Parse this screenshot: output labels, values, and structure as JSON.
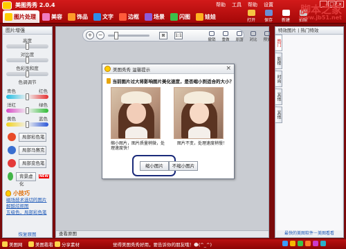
{
  "app": {
    "title": "美图秀秀 2.0.4"
  },
  "top_links": [
    "帮助",
    "工具",
    "帮助",
    "设置"
  ],
  "window_buttons": [
    "_",
    "□",
    "×"
  ],
  "main_tabs": [
    {
      "label": "图片处理",
      "color": "#ffcc00"
    },
    {
      "label": "美容",
      "color": "#f07bbf"
    },
    {
      "label": "饰品",
      "color": "#ff9a2a"
    },
    {
      "label": "文字",
      "color": "#2f8ee8"
    },
    {
      "label": "边框",
      "color": "#ff5a3a"
    },
    {
      "label": "场景",
      "color": "#8e5bd8"
    },
    {
      "label": "闪图",
      "color": "#3bbf4a"
    },
    {
      "label": "娃娃",
      "color": "#ffb020"
    }
  ],
  "top_tools": [
    {
      "label": "打开",
      "color": "#f5c542"
    },
    {
      "label": "保存",
      "color": "#6a8fd6"
    },
    {
      "label": "新建",
      "color": "#ffffff"
    },
    {
      "label": "拍照",
      "color": "#cccccc"
    }
  ],
  "watermark": {
    "text": "脚本之家",
    "url": "www.jb51.net"
  },
  "left_panel": {
    "header": "图片增强",
    "sliders": [
      {
        "label": "高度",
        "type": "plain",
        "value": 0.5
      },
      {
        "label": "对比度",
        "type": "plain",
        "value": 0.5
      },
      {
        "label": "色彩饱和度",
        "type": "plain",
        "value": 0.5
      },
      {
        "label": "色调调节",
        "type": "cyan",
        "left": "青色",
        "right": "红色",
        "value": 0.5
      },
      {
        "type": "mag",
        "left": "洋红",
        "right": "绿色",
        "value": 0.5
      },
      {
        "type": "yel",
        "left": "黄色",
        "right": "蓝色",
        "value": 0.5
      }
    ],
    "effects": [
      {
        "label": "局部彩色笔",
        "color": "#e84a28"
      },
      {
        "label": "局部马赛克",
        "color": "#3a6fd0"
      },
      {
        "label": "局部变色笔",
        "color": "#e43a3a"
      },
      {
        "label": "背景虚化",
        "color": "#43b548",
        "badge": "NEW"
      }
    ],
    "tips_title": "小技巧",
    "tips": [
      "磁场技术选切的图片",
      "解酷炫抠图",
      "五级色，局部彩色笔"
    ],
    "footer": "恢复原图"
  },
  "canvas": {
    "zoom": {
      "in": "+",
      "out": "−",
      "value": 0.15
    },
    "edit_tools": [
      "撤销",
      "重做",
      "原图",
      "对比",
      "预览"
    ],
    "footer": "查看原图"
  },
  "dialog": {
    "title": "美图秀秀 温馨提示",
    "message": "当前图片过大将影响图片美化速度，是否缩小到适合的大小？",
    "left_caption": "缩小图片，图片质量稍微，处理速度快！",
    "right_caption": "图片不变，处理速度稍慢！",
    "btn_shrink": "缩小图片",
    "btn_keep": "不缩小图片"
  },
  "right_panel": {
    "header": "特效图片 | 热门特效",
    "tabs": [
      "热门",
      "影楼",
      "时尚",
      "其他",
      "其他"
    ],
    "footer": "最快的美图软件－美图看看"
  },
  "bottom_bar": {
    "items": [
      "美图网",
      "美图看看",
      "分享素材"
    ],
    "status": "觉得美图秀秀好用，要告诉你的朋友哦！☻(^_^)",
    "dots": [
      "#3b9cff",
      "#f5b800",
      "#3bc44b",
      "#ff7b2a",
      "#cc3ac9",
      "#2bb0c9"
    ]
  }
}
